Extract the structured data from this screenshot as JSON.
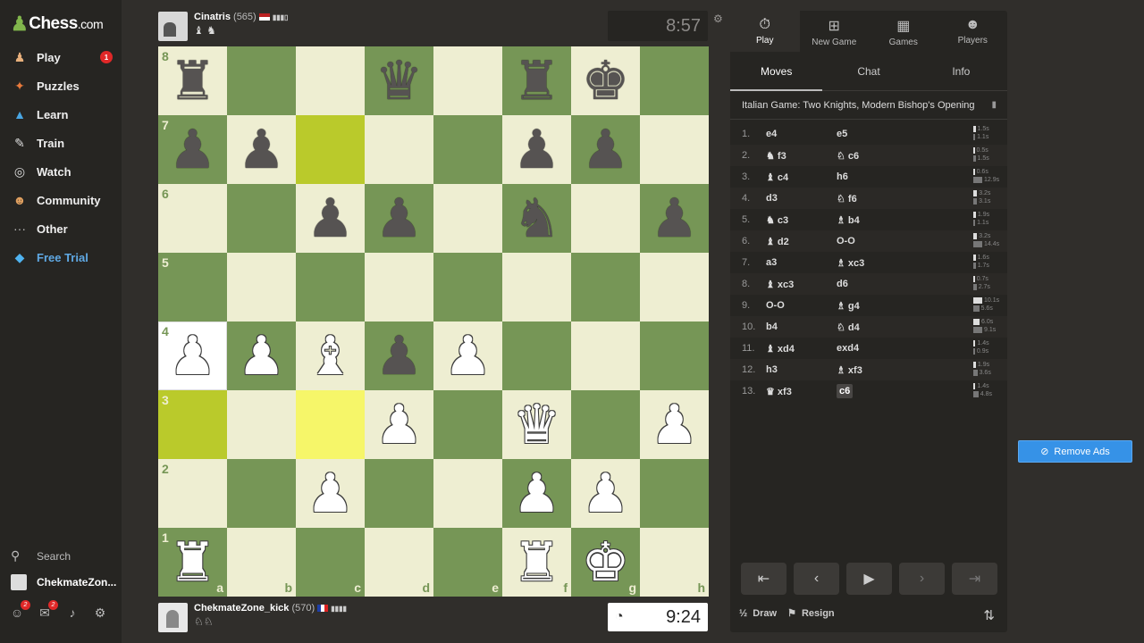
{
  "sidebar": {
    "logo": "Chess",
    "logo_tld": ".com",
    "items": [
      {
        "label": "Play",
        "icon": "play-icon",
        "badge": "1"
      },
      {
        "label": "Puzzles",
        "icon": "puzzle-icon"
      },
      {
        "label": "Learn",
        "icon": "graduation-cap-icon"
      },
      {
        "label": "Train",
        "icon": "train-icon"
      },
      {
        "label": "Watch",
        "icon": "binoculars-icon"
      },
      {
        "label": "Community",
        "icon": "community-icon"
      },
      {
        "label": "Other",
        "icon": "more-dots-icon"
      },
      {
        "label": "Free Trial",
        "icon": "diamond-icon"
      }
    ],
    "search_label": "Search",
    "username": "ChekmateZon...",
    "friends_badge": "2",
    "messages_badge": "2"
  },
  "top_player": {
    "name": "Cinatris",
    "rating": "(565)",
    "captured": "♝ ♞",
    "clock": "8:57"
  },
  "bottom_player": {
    "name": "ChekmateZone_kick",
    "rating": "(570)",
    "captured": "♘♘",
    "clock": "9:24"
  },
  "board": {
    "ranks": [
      [
        "br",
        "",
        "",
        "bq",
        "",
        "br",
        "bk",
        ""
      ],
      [
        "bp",
        "bp",
        "",
        "",
        "",
        "bp",
        "bp",
        ""
      ],
      [
        "",
        "",
        "bp",
        "bp",
        "",
        "bn",
        "",
        "bp"
      ],
      [
        "",
        "",
        "",
        "",
        "",
        "",
        "",
        ""
      ],
      [
        "wp",
        "wp",
        "wb",
        "bp",
        "wp",
        "",
        "",
        ""
      ],
      [
        "",
        "",
        "",
        "wp",
        "",
        "wq",
        "",
        "wp"
      ],
      [
        "",
        "",
        "wp",
        "",
        "",
        "wp",
        "wp",
        ""
      ],
      [
        "wr",
        "",
        "",
        "",
        "",
        "wr",
        "wk",
        ""
      ]
    ],
    "rank_labels": [
      "8",
      "7",
      "6",
      "5",
      "4",
      "3",
      "2",
      "1"
    ],
    "file_labels": [
      "a",
      "b",
      "c",
      "d",
      "e",
      "f",
      "g",
      "h"
    ]
  },
  "panel": {
    "top_tabs": [
      {
        "label": "Play",
        "icon": "stopwatch-icon"
      },
      {
        "label": "New Game",
        "icon": "plus-square-icon"
      },
      {
        "label": "Games",
        "icon": "board-icon"
      },
      {
        "label": "Players",
        "icon": "players-icon"
      }
    ],
    "sub_tabs": [
      "Moves",
      "Chat",
      "Info"
    ],
    "opening": "Italian Game: Two Knights, Modern Bishop's Opening",
    "moves": [
      {
        "n": "1.",
        "w": "e4",
        "b": "e5",
        "tw": "1.5s",
        "tb": "1.1s"
      },
      {
        "n": "2.",
        "w": "♞ f3",
        "b": "♘ c6",
        "tw": "0.5s",
        "tb": "1.5s"
      },
      {
        "n": "3.",
        "w": "♝ c4",
        "b": "h6",
        "tw": "0.6s",
        "tb": "12.9s"
      },
      {
        "n": "4.",
        "w": "d3",
        "b": "♘ f6",
        "tw": "3.2s",
        "tb": "3.1s"
      },
      {
        "n": "5.",
        "w": "♞ c3",
        "b": "♗ b4",
        "tw": "1.9s",
        "tb": "1.1s"
      },
      {
        "n": "6.",
        "w": "♝ d2",
        "b": "O-O",
        "tw": "3.2s",
        "tb": "14.4s"
      },
      {
        "n": "7.",
        "w": "a3",
        "b": "♗ xc3",
        "tw": "1.6s",
        "tb": "1.7s"
      },
      {
        "n": "8.",
        "w": "♝ xc3",
        "b": "d6",
        "tw": "0.7s",
        "tb": "2.7s"
      },
      {
        "n": "9.",
        "w": "O-O",
        "b": "♗ g4",
        "tw": "10.1s",
        "tb": "5.6s"
      },
      {
        "n": "10.",
        "w": "b4",
        "b": "♘ d4",
        "tw": "6.0s",
        "tb": "9.1s"
      },
      {
        "n": "11.",
        "w": "♝ xd4",
        "b": "exd4",
        "tw": "1.4s",
        "tb": "0.9s"
      },
      {
        "n": "12.",
        "w": "h3",
        "b": "♗ xf3",
        "tw": "1.9s",
        "tb": "3.6s"
      },
      {
        "n": "13.",
        "w": "♛ xf3",
        "b": "c6",
        "tw": "1.4s",
        "tb": "4.8s"
      }
    ],
    "draw_label": "Draw",
    "resign_label": "Resign",
    "draw_icon": "½"
  },
  "ads": {
    "label": "Remove Ads"
  }
}
